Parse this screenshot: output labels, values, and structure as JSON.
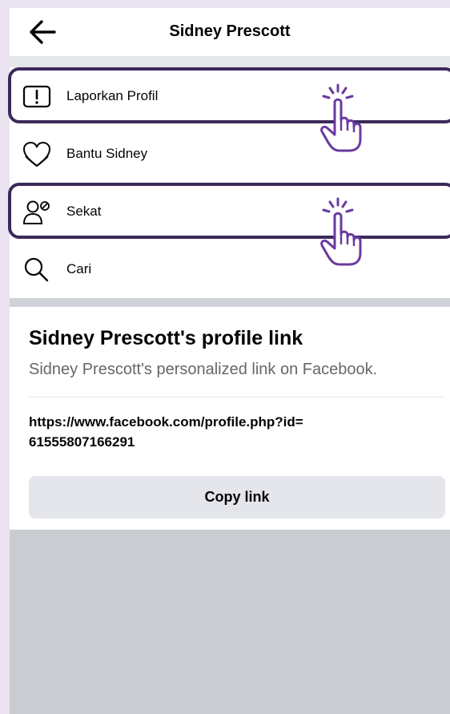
{
  "header": {
    "title": "Sidney Prescott"
  },
  "menu": {
    "items": [
      {
        "label": "Laporkan Profil",
        "icon": "report-icon"
      },
      {
        "label": "Bantu Sidney",
        "icon": "heart-icon"
      },
      {
        "label": "Sekat",
        "icon": "block-user-icon"
      },
      {
        "label": "Cari",
        "icon": "search-icon"
      }
    ]
  },
  "profile_link": {
    "title": "Sidney Prescott's profile link",
    "subtitle": "Sidney Prescott's personalized link on Facebook.",
    "url_line1": "https://www.facebook.com/profile.php?id=",
    "url_line2": "61555807166291",
    "copy_label": "Copy link"
  },
  "colors": {
    "highlight": "#3b2a59",
    "hand": "#6a3aa0",
    "background": "#ebe3f2"
  }
}
